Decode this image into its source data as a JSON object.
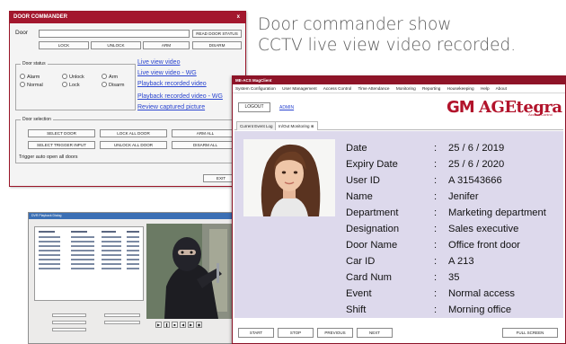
{
  "headline": {
    "line1": "Door commander show",
    "line2": "CCTV live view video recorded."
  },
  "door_commander": {
    "title": "DOOR COMMANDER",
    "close": "x",
    "door_label": "Door",
    "read_status": "READ DOOR STATUS",
    "buttons": {
      "lock": "LOCK",
      "unlock": "UNLOCK",
      "arm": "ARM",
      "disarm": "DISARM"
    },
    "door_status_label": "Door status",
    "status_options": [
      "Alarm",
      "Unlock",
      "Arm",
      "Normal",
      "Lock",
      "Disarm"
    ],
    "links": [
      "Live view video",
      "Live view video - WG",
      "Playback recorded video",
      "Playback recorded video - WG",
      "Review captured picture"
    ],
    "door_selection_label": "Door selection",
    "selection_buttons": [
      "SELECT DOOR",
      "LOCK ALL DOOR",
      "ARM ALL",
      "SELECT TRIGGER INPUT",
      "UNLOCK ALL DOOR",
      "DISARM ALL"
    ],
    "trigger_text": "Trigger auto open all doors",
    "exit": "EXIT"
  },
  "playback": {
    "title": "DVR Playback Dialog"
  },
  "mag_client": {
    "title": "ME-ACS MagClient",
    "menu": [
      "System Configuration",
      "User Management",
      "Access Control",
      "Time Attendance",
      "Monitoring",
      "Reporting",
      "Housekeeping",
      "Help",
      "About"
    ],
    "logout": "LOGOUT",
    "user": "ADMIN",
    "logo_mark": "GM",
    "logo_text": "AGEtegra",
    "logo_sub": "Access Control",
    "tabs": [
      "Current Event Log",
      "In/Out Monitoring"
    ],
    "tab_close": "⊗",
    "details": [
      {
        "key": "Date",
        "value": "25 / 6 / 2019"
      },
      {
        "key": "Expiry Date",
        "value": "25 / 6 / 2020"
      },
      {
        "key": "User ID",
        "value": "A 31543666"
      },
      {
        "key": "Name",
        "value": "Jenifer"
      },
      {
        "key": "Department",
        "value": "Marketing department"
      },
      {
        "key": "Designation",
        "value": "Sales executive"
      },
      {
        "key": "Door Name",
        "value": "Office front door"
      },
      {
        "key": "Car ID",
        "value": "A 213"
      },
      {
        "key": "Card Num",
        "value": "35"
      },
      {
        "key": "Event",
        "value": "Normal access"
      },
      {
        "key": "Shift",
        "value": "Morning office"
      }
    ],
    "footer": {
      "start": "START",
      "stop": "STOP",
      "previous": "PREVIOUS",
      "next": "NEXT",
      "fullscreen": "FULL SCREEN"
    },
    "colors": {
      "brand": "#b2132b",
      "panel": "#ddd9ec",
      "title_bar": "#8e1428"
    }
  }
}
